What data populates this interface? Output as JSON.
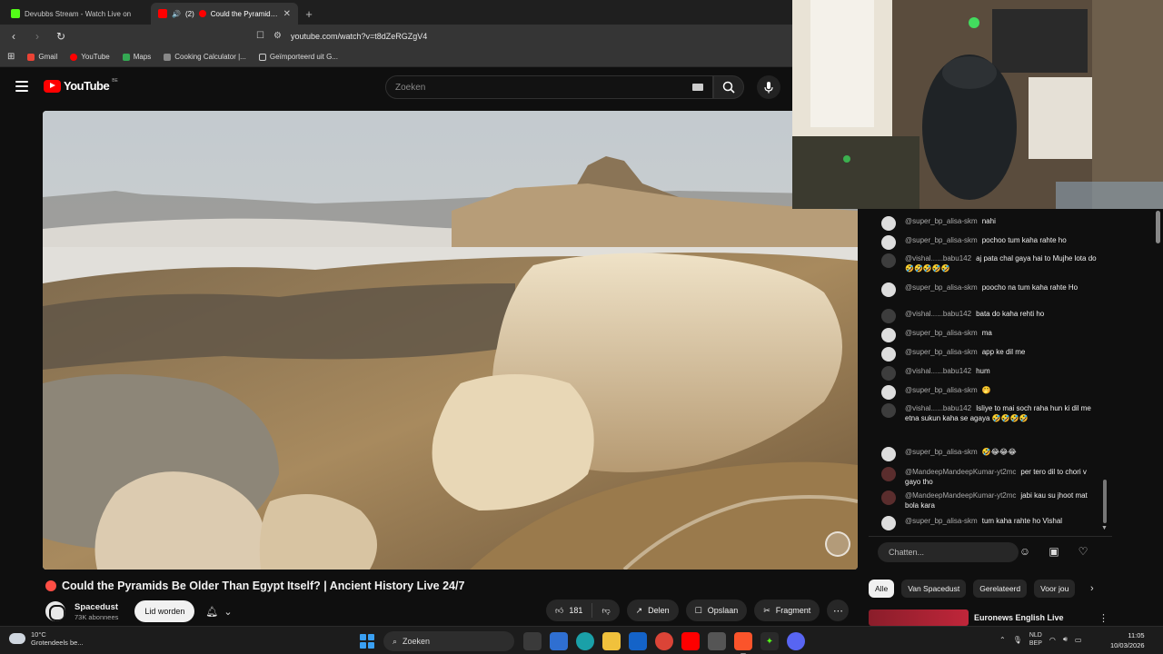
{
  "browser": {
    "tabs": [
      {
        "title": "Devubbs Stream - Watch Live on",
        "favicon_color": "#53fc18",
        "active": false
      },
      {
        "prefix": "(2)",
        "title": "Could the Pyramids Be",
        "favicon_color": "#ff0000",
        "active": true
      }
    ],
    "url": "youtube.com/watch?v=t8dZeRGZgV4",
    "bookmarks": [
      {
        "label": "Gmail",
        "color": "#ea4335"
      },
      {
        "label": "YouTube",
        "color": "#ff0000"
      },
      {
        "label": "Maps",
        "color": "#34a853"
      },
      {
        "label": "Cooking Calculator |...",
        "color": "#888888"
      },
      {
        "label": "Geïmporteerd uit G...",
        "color": "#aaaaaa"
      }
    ]
  },
  "youtube": {
    "logo_text": "YouTube",
    "country_code": "BE",
    "search_placeholder": "Zoeken",
    "video": {
      "title": "Could the Pyramids Be Older Than Egypt Itself? | Ancient History Live 24/7",
      "channel": "Spacedust",
      "subscribers": "73K abonnees",
      "join_label": "Lid worden",
      "likes": "181",
      "share_label": "Delen",
      "save_label": "Opslaan",
      "clip_label": "Fragment"
    },
    "chat": {
      "input_placeholder": "Chatten...",
      "messages": [
        {
          "author": "@super_bp_alisa-skm",
          "text": "nahi",
          "avatar": "light"
        },
        {
          "author": "@super_bp_alisa-skm",
          "text": "pochoo tum kaha rahte ho",
          "avatar": "light"
        },
        {
          "author": "@vishal......babu142",
          "text": "aj pata chal gaya hai to Mujhe lota do 🤣🤣🤣🤣🤣",
          "avatar": "dark"
        },
        {
          "author": "@super_bp_alisa-skm",
          "text": "poocho na tum kaha rahte Ho",
          "avatar": "light"
        },
        {
          "author": "@vishal......babu142",
          "text": "bata do kaha rehti ho",
          "avatar": "dark"
        },
        {
          "author": "@super_bp_alisa-skm",
          "text": "ma",
          "avatar": "light"
        },
        {
          "author": "@super_bp_alisa-skm",
          "text": "app ke dil me",
          "avatar": "light"
        },
        {
          "author": "@vishal......babu142",
          "text": "hum",
          "avatar": "dark"
        },
        {
          "author": "@super_bp_alisa-skm",
          "text": "🤭",
          "avatar": "light"
        },
        {
          "author": "@vishal......babu142",
          "text": "Isliye to mai soch raha hun ki dil me etna sukun kaha se agaya 🤣🤣🤣🤣",
          "avatar": "dark"
        },
        {
          "author": "@super_bp_alisa-skm",
          "text": "🤣😂😂😂",
          "avatar": "light"
        },
        {
          "author": "@MandeepMandeepKumar-yt2mc",
          "text": "per tero dil to chori v gayo tho",
          "avatar": "red"
        },
        {
          "author": "@MandeepMandeepKumar-yt2mc",
          "text": "jabi kau su jhoot mat bola kara",
          "avatar": "red"
        },
        {
          "author": "@super_bp_alisa-skm",
          "text": "tum kaha rahte ho Vishal",
          "avatar": "light"
        }
      ]
    },
    "chips": [
      "Alle",
      "Van Spacedust",
      "Gerelateerd",
      "Voor jou"
    ],
    "next_video_title": "Euronews English Live"
  },
  "taskbar": {
    "weather_temp": "10°C",
    "weather_desc": "Grotendeels be...",
    "search_label": "Zoeken",
    "lang_top": "NLD",
    "lang_bottom": "BEP",
    "time": "11:05",
    "date": "10/03/2026"
  }
}
